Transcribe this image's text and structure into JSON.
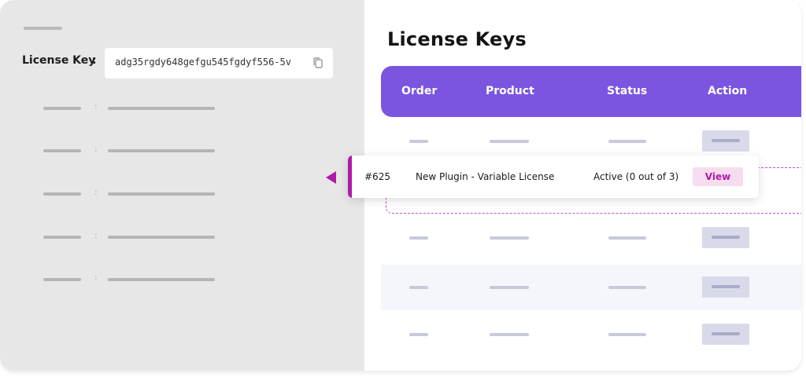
{
  "license_panel": {
    "label": "License Key",
    "colon": ":",
    "value": "adg35rgdy648gefgu545fgdyf556-5v",
    "copy_icon": "copy-icon",
    "placeholder_colon": ":"
  },
  "license_keys": {
    "title": "License Keys",
    "columns": [
      "Order",
      "Product",
      "Status",
      "Action"
    ],
    "highlighted_row": {
      "order": "#625",
      "product": "New Plugin - Variable License",
      "status": "Active (0 out of 3)",
      "action_label": "View"
    }
  },
  "colors": {
    "header": "#7b55e0",
    "accent": "#b01aa8",
    "view_bg": "#f7dcef",
    "panel_bg": "#e7e7e7"
  }
}
